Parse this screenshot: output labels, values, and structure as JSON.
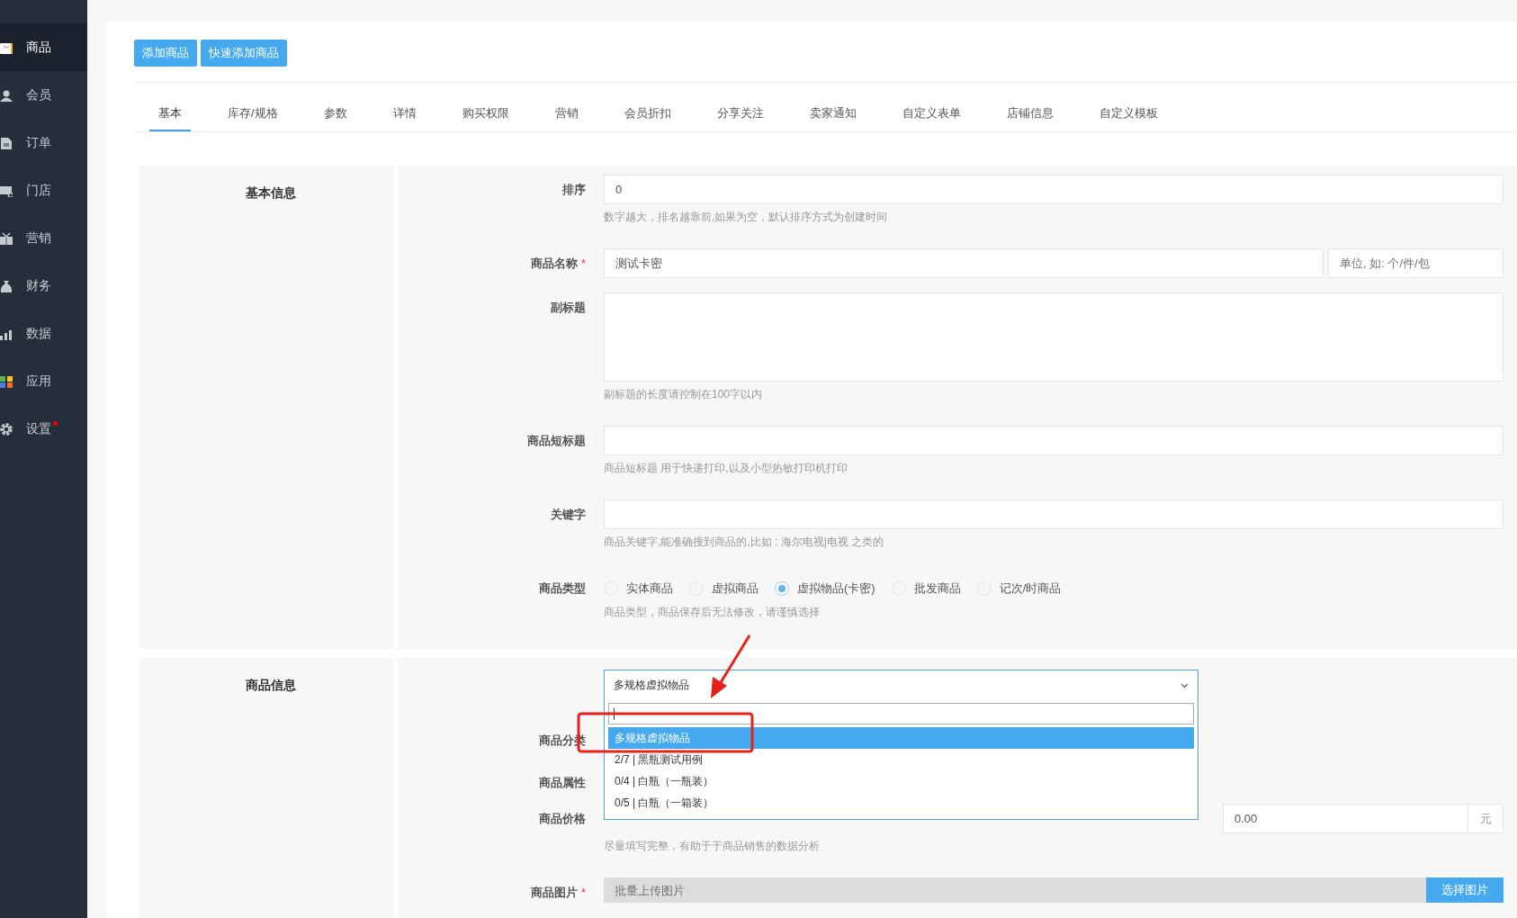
{
  "sidebar": {
    "items": [
      {
        "label": "商品",
        "selected": true,
        "dot": false
      },
      {
        "label": "会员",
        "selected": false,
        "dot": false
      },
      {
        "label": "订单",
        "selected": false,
        "dot": false
      },
      {
        "label": "门店",
        "selected": false,
        "dot": false
      },
      {
        "label": "营销",
        "selected": false,
        "dot": false
      },
      {
        "label": "财务",
        "selected": false,
        "dot": false
      },
      {
        "label": "数据",
        "selected": false,
        "dot": false
      },
      {
        "label": "应用",
        "selected": false,
        "dot": false
      },
      {
        "label": "设置",
        "selected": false,
        "dot": true
      }
    ]
  },
  "toolbar": {
    "buttons": [
      "添加商品",
      "快速添加商品"
    ]
  },
  "tabs": [
    {
      "label": "基本",
      "selected": true
    },
    {
      "label": "库存/规格",
      "selected": false
    },
    {
      "label": "参数",
      "selected": false
    },
    {
      "label": "详情",
      "selected": false
    },
    {
      "label": "购买权限",
      "selected": false
    },
    {
      "label": "营销",
      "selected": false
    },
    {
      "label": "会员折扣",
      "selected": false
    },
    {
      "label": "分享关注",
      "selected": false
    },
    {
      "label": "卖家通知",
      "selected": false
    },
    {
      "label": "自定义表单",
      "selected": false
    },
    {
      "label": "店铺信息",
      "selected": false
    },
    {
      "label": "自定义模板",
      "selected": false
    }
  ],
  "sections": [
    {
      "title": "基本信息",
      "fields": [
        {
          "kind": "input",
          "label": "排序",
          "value": "0",
          "help": "数字越大，排名越靠前,如果为空，默认排序方式为创建时间"
        },
        {
          "kind": "input_unit",
          "label": "商品名称",
          "mark": "*",
          "value": "测试卡密",
          "unit_placeholder": "单位, 如: 个/件/包"
        },
        {
          "kind": "textarea",
          "label": "副标题",
          "help": "副标题的长度请控制在100字以内"
        },
        {
          "kind": "input",
          "label": "商品短标题",
          "help": "商品短标题 用于快递打印,以及小型热敏打印机打印"
        },
        {
          "kind": "input",
          "label": "关键字",
          "help": "商品关键字,能准确搜到商品的,比如 : 海尔电视|电视 之类的"
        },
        {
          "kind": "radio",
          "label": "商品类型",
          "options": [
            {
              "label": "实体商品",
              "selected": false
            },
            {
              "label": "虚拟商品",
              "selected": false
            },
            {
              "label": "虚拟物品(卡密)",
              "selected": true
            },
            {
              "label": "批发商品",
              "selected": false
            },
            {
              "label": "记次/时商品",
              "selected": false
            }
          ],
          "help": "商品类型，商品保存后无法修改，请谨慎选择"
        }
      ]
    },
    {
      "title": "商品信息",
      "dropdown": {
        "kind": "select",
        "value": "多规格虚拟物品",
        "open": true,
        "options": [
          {
            "label": "多规格虚拟物品",
            "selected": true
          },
          {
            "label": "2/7 | 黑瓶测试用例",
            "selected": false
          },
          {
            "label": "0/4 | 白瓶（一瓶装）",
            "selected": false
          },
          {
            "label": "0/5 | 白瓶（一箱装）",
            "selected": false
          }
        ]
      },
      "fields": [
        {
          "kind": "blank",
          "label": "商品分类"
        },
        {
          "kind": "blank",
          "label": "商品属性"
        },
        {
          "kind": "price",
          "label": "商品价格",
          "value": "0.00",
          "suffix": "元",
          "help": "尽量填写完整，有助于于商品销售的数据分析"
        },
        {
          "kind": "image",
          "label": "商品图片",
          "mark": "*",
          "placeholder": "批量上传图片",
          "button": "选择图片"
        }
      ]
    }
  ]
}
